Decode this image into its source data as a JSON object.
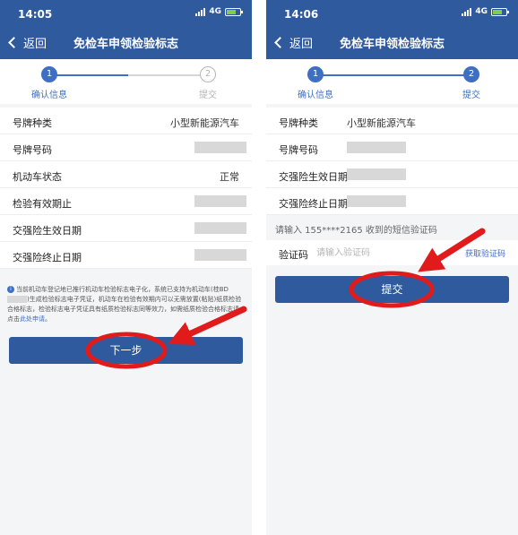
{
  "colors": {
    "header": "#2f5a9e",
    "accent": "#3f6fc2",
    "annotation": "#e11b1b"
  },
  "screens": [
    {
      "status": {
        "time": "14:05",
        "network": "4G"
      },
      "nav": {
        "back": "返回",
        "title": "免检车申领检验标志"
      },
      "steps": [
        {
          "num": "1",
          "label": "确认信息"
        },
        {
          "num": "2",
          "label": "提交"
        }
      ],
      "fields": [
        {
          "label": "号牌种类",
          "value": "小型新能源汽车"
        },
        {
          "label": "号牌号码",
          "value": ""
        },
        {
          "label": "机动车状态",
          "value": "正常"
        },
        {
          "label": "检验有效期止",
          "value": ""
        },
        {
          "label": "交强险生效日期",
          "value": ""
        },
        {
          "label": "交强险终止日期",
          "value": ""
        }
      ],
      "notice": {
        "text1": "当前机动车登记地已推行机动车检验标志电子化，系统已支持为机动车(桂BD",
        "text2": ")生成检验标志电子凭证，机动车在检验有效期内可以无需放置(粘贴)纸质检验合格标志，检验标志电子凭证具有纸质检验标志同等效力，如需纸质检验合格标志请点击",
        "link": "此处申请",
        "end": "。"
      },
      "button": "下一步"
    },
    {
      "status": {
        "time": "14:06",
        "network": "4G"
      },
      "nav": {
        "back": "返回",
        "title": "免检车申领检验标志"
      },
      "steps": [
        {
          "num": "1",
          "label": "确认信息"
        },
        {
          "num": "2",
          "label": "提交"
        }
      ],
      "fields": [
        {
          "label": "号牌种类",
          "value": "小型新能源汽车"
        },
        {
          "label": "号牌号码",
          "value": ""
        },
        {
          "label": "交强险生效日期",
          "value": ""
        },
        {
          "label": "交强险终止日期",
          "value": ""
        }
      ],
      "sms_hint": "请输入 155****2165 收到的短信验证码",
      "code": {
        "label": "验证码",
        "placeholder": "请输入验证码",
        "get_code": "获取验证码"
      },
      "button": "提交"
    }
  ]
}
